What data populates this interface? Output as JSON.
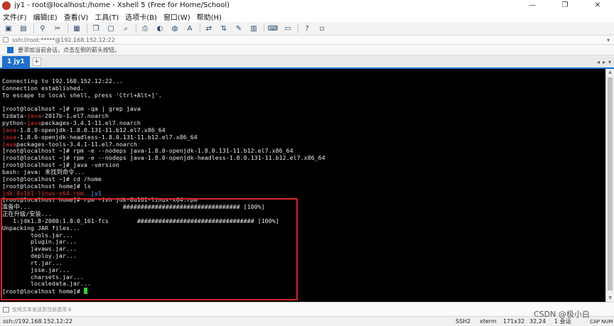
{
  "window": {
    "title": "jy1 - root@localhost:/home - Xshell 5 (Free for Home/School)",
    "controls": [
      "—",
      "❐",
      "✕"
    ]
  },
  "menu": [
    "文件(F)",
    "编辑(E)",
    "查看(V)",
    "工具(T)",
    "选项卡(B)",
    "窗口(W)",
    "帮助(H)"
  ],
  "toolbar": {
    "icons": [
      "new-session-icon",
      "open-folder-icon",
      "link-icon",
      "unlink-icon",
      "properties-icon",
      "copy-icon",
      "paste-icon",
      "find-icon",
      "print-icon",
      "color-scheme-icon",
      "globe-icon",
      "font-icon",
      "transfer-icon",
      "xftp-icon",
      "compose-icon",
      "lock-icon",
      "keyboard-icon",
      "layout-icon",
      "help-icon",
      "extra-icon"
    ]
  },
  "address": {
    "text": "ssh://root:*****@192.168.152.12:22"
  },
  "hint": {
    "text": "要添加当前会话，点击左侧的箭头按钮。"
  },
  "tabs": {
    "active": "1 jy1",
    "add": "+"
  },
  "terminal": {
    "lines": [
      [
        {
          "t": "Connecting to 192.168.152.12:22..."
        }
      ],
      [
        {
          "t": "Connection established."
        }
      ],
      [
        {
          "t": "To escape to local shell, press 'Ctrl+Alt+]'."
        }
      ],
      [
        {
          "t": ""
        }
      ],
      [
        {
          "t": "[root@localhost ~]# rpm -qa | grep java"
        }
      ],
      [
        {
          "t": "tzdata-"
        },
        {
          "t": "java",
          "c": "red"
        },
        {
          "t": "-2017b-1.el7.noarch"
        }
      ],
      [
        {
          "t": "python-"
        },
        {
          "t": "java",
          "c": "red"
        },
        {
          "t": "packages-3.4.1-11.el7.noarch"
        }
      ],
      [
        {
          "t": "java",
          "c": "red"
        },
        {
          "t": "-1.8.0-openjdk-1.8.0.131-11.b12.el7.x86_64"
        }
      ],
      [
        {
          "t": "java",
          "c": "red"
        },
        {
          "t": "-1.8.0-openjdk-headless-1.8.0.131-11.b12.el7.x86_64"
        }
      ],
      [
        {
          "t": "java",
          "c": "red"
        },
        {
          "t": "packages-tools-3.4.1-11.el7.noarch"
        }
      ],
      [
        {
          "t": "[root@localhost ~]# rpm -e --nodeps java-1.8.0-openjdk-1.8.0.131-11.b12.el7.x86_64"
        }
      ],
      [
        {
          "t": "[root@localhost ~]# rpm -e --nodeps java-1.8.0-openjdk-headless-1.8.0.131-11.b12.el7.x86_64"
        }
      ],
      [
        {
          "t": "[root@localhost ~]# java -version"
        }
      ],
      [
        {
          "t": "bash: java: 未找到命令..."
        }
      ],
      [
        {
          "t": "[root@localhost ~]# cd /home"
        }
      ],
      [
        {
          "t": "[root@localhost home]# ls"
        }
      ],
      [
        {
          "t": "jdk-8u161-linux-x64.rpm",
          "c": "red"
        },
        {
          "t": "  "
        },
        {
          "t": "jy1",
          "c": "blue"
        }
      ],
      [
        {
          "t": "[root@localhost home]# rpm -ivh jdk-8u161-linux-x64.rpm"
        }
      ],
      [
        {
          "t": "准备中...                          ################################# [100%]"
        }
      ],
      [
        {
          "t": "正在升级/安装..."
        }
      ],
      [
        {
          "t": "   1:jdk1.8-2000:1.8.0_161-fcs        ################################# [100%]"
        }
      ],
      [
        {
          "t": "Unpacking JAR files..."
        }
      ],
      [
        {
          "t": "        tools.jar..."
        }
      ],
      [
        {
          "t": "        plugin.jar..."
        }
      ],
      [
        {
          "t": "        javaws.jar..."
        }
      ],
      [
        {
          "t": "        deploy.jar..."
        }
      ],
      [
        {
          "t": "        rt.jar..."
        }
      ],
      [
        {
          "t": "        jsse.jar..."
        }
      ],
      [
        {
          "t": "        charsets.jar..."
        }
      ],
      [
        {
          "t": "        localedata.jar..."
        }
      ],
      [
        {
          "t": "[root@localhost home]# "
        },
        {
          "cursor": true
        }
      ]
    ]
  },
  "compose": {
    "text": "仅将文本发送到当前选项卡"
  },
  "status": {
    "host": "ssh://192.168.152.12:22",
    "protocol": "SSH2",
    "term": "xterm",
    "size": "171x32",
    "position": "32,24",
    "sessions": "1 会话",
    "watermark": "CSDN @极小白",
    "keys": "CAP NUM"
  },
  "colors": {
    "tab_accent": "#1f6fd0",
    "terminal_bg": "#000000",
    "highlight_border": "#d4262a",
    "cursor": "#2fd62f"
  }
}
